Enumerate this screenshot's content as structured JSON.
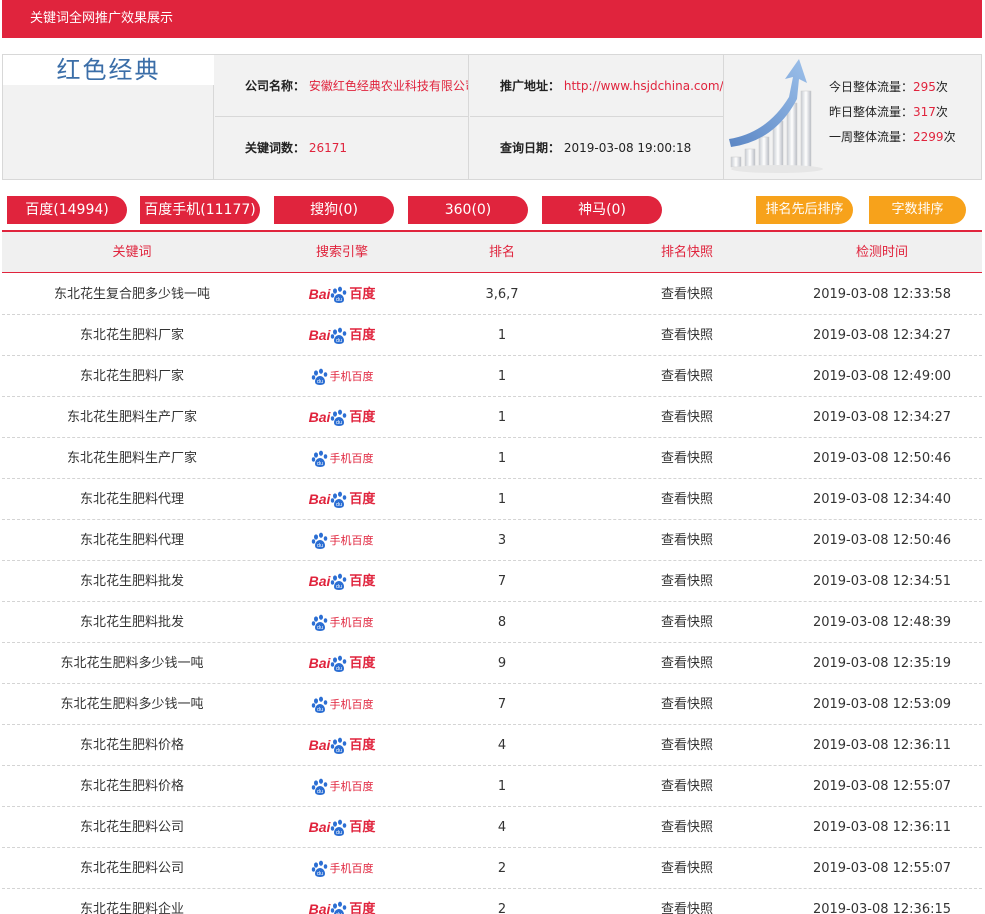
{
  "header": {
    "title": "关键词全网推广效果展示"
  },
  "company": {
    "logo_text": "红色经典",
    "name_label": "公司名称：",
    "name": "安徽红色经典农业科技有限公司",
    "url_label": "推广地址：",
    "url": "http://www.hsjdchina.com/",
    "keywords_label": "关键词数：",
    "keywords": "26171",
    "date_label": "查询日期：",
    "date": "2019-03-08 19:00:18"
  },
  "stats": {
    "today_label": "今日整体流量：",
    "today": "295",
    "today_unit": "次",
    "yesterday_label": "昨日整体流量：",
    "yesterday": "317",
    "yesterday_unit": "次",
    "week_label": "一周整体流量：",
    "week": "2299",
    "week_unit": "次"
  },
  "filters": {
    "baidu": "百度(14994)",
    "baidu_mobile": "百度手机(11177)",
    "sogou": "搜狗(0)",
    "s360": "360(0)",
    "shenma": "神马(0)",
    "sort_rank": "排名先后排序",
    "sort_chars": "字数排序"
  },
  "table": {
    "headers": [
      "关键词",
      "搜索引擎",
      "排名",
      "排名快照",
      "检测时间"
    ],
    "engine_labels": {
      "baidu_bai": "Bai",
      "baidu_du": "百度",
      "mobile": "手机百度"
    },
    "rows": [
      {
        "keyword": "东北花生复合肥多少钱一吨",
        "engine": "baidu",
        "rank": "3,6,7",
        "snapshot": "查看快照",
        "time": "2019-03-08 12:33:58"
      },
      {
        "keyword": "东北花生肥料厂家",
        "engine": "baidu",
        "rank": "1",
        "snapshot": "查看快照",
        "time": "2019-03-08 12:34:27"
      },
      {
        "keyword": "东北花生肥料厂家",
        "engine": "mobile",
        "rank": "1",
        "snapshot": "查看快照",
        "time": "2019-03-08 12:49:00"
      },
      {
        "keyword": "东北花生肥料生产厂家",
        "engine": "baidu",
        "rank": "1",
        "snapshot": "查看快照",
        "time": "2019-03-08 12:34:27"
      },
      {
        "keyword": "东北花生肥料生产厂家",
        "engine": "mobile",
        "rank": "1",
        "snapshot": "查看快照",
        "time": "2019-03-08 12:50:46"
      },
      {
        "keyword": "东北花生肥料代理",
        "engine": "baidu",
        "rank": "1",
        "snapshot": "查看快照",
        "time": "2019-03-08 12:34:40"
      },
      {
        "keyword": "东北花生肥料代理",
        "engine": "mobile",
        "rank": "3",
        "snapshot": "查看快照",
        "time": "2019-03-08 12:50:46"
      },
      {
        "keyword": "东北花生肥料批发",
        "engine": "baidu",
        "rank": "7",
        "snapshot": "查看快照",
        "time": "2019-03-08 12:34:51"
      },
      {
        "keyword": "东北花生肥料批发",
        "engine": "mobile",
        "rank": "8",
        "snapshot": "查看快照",
        "time": "2019-03-08 12:48:39"
      },
      {
        "keyword": "东北花生肥料多少钱一吨",
        "engine": "baidu",
        "rank": "9",
        "snapshot": "查看快照",
        "time": "2019-03-08 12:35:19"
      },
      {
        "keyword": "东北花生肥料多少钱一吨",
        "engine": "mobile",
        "rank": "7",
        "snapshot": "查看快照",
        "time": "2019-03-08 12:53:09"
      },
      {
        "keyword": "东北花生肥料价格",
        "engine": "baidu",
        "rank": "4",
        "snapshot": "查看快照",
        "time": "2019-03-08 12:36:11"
      },
      {
        "keyword": "东北花生肥料价格",
        "engine": "mobile",
        "rank": "1",
        "snapshot": "查看快照",
        "time": "2019-03-08 12:55:07"
      },
      {
        "keyword": "东北花生肥料公司",
        "engine": "baidu",
        "rank": "4",
        "snapshot": "查看快照",
        "time": "2019-03-08 12:36:11"
      },
      {
        "keyword": "东北花生肥料公司",
        "engine": "mobile",
        "rank": "2",
        "snapshot": "查看快照",
        "time": "2019-03-08 12:55:07"
      },
      {
        "keyword": "东北花生肥料企业",
        "engine": "baidu",
        "rank": "2",
        "snapshot": "查看快照",
        "time": "2019-03-08 12:36:15"
      }
    ]
  },
  "colors": {
    "accent": "#e0243d",
    "orange": "#f7a21b",
    "logo_blue": "#3b6ea8"
  }
}
